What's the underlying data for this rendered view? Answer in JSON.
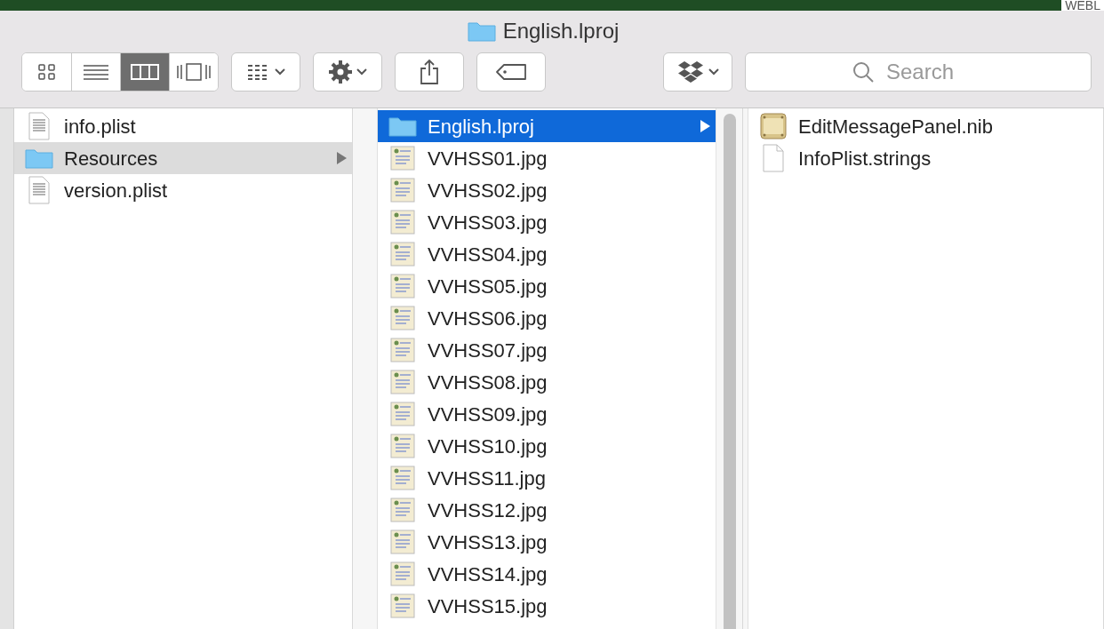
{
  "desktop": {
    "label": "WEBL"
  },
  "window": {
    "title": "English.lproj"
  },
  "toolbar": {
    "view_modes": [
      {
        "kind": "icons",
        "selected": false
      },
      {
        "kind": "list",
        "selected": false
      },
      {
        "kind": "columns",
        "selected": true
      },
      {
        "kind": "coverflow",
        "selected": false
      }
    ],
    "buttons": [
      {
        "kind": "arrange"
      },
      {
        "kind": "action"
      },
      {
        "kind": "share"
      },
      {
        "kind": "tag"
      },
      {
        "kind": "dropbox"
      }
    ],
    "search": {
      "placeholder": "Search"
    }
  },
  "columns": [
    {
      "active": false,
      "items": [
        {
          "name": "info.plist",
          "kind": "plist",
          "selected": false
        },
        {
          "name": "Resources",
          "kind": "folder",
          "selected": true
        },
        {
          "name": "version.plist",
          "kind": "plist",
          "selected": false
        }
      ]
    },
    {
      "active": true,
      "items": [
        {
          "name": "English.lproj",
          "kind": "folder",
          "selected": true
        },
        {
          "name": "VVHSS01.jpg",
          "kind": "jpg",
          "selected": false
        },
        {
          "name": "VVHSS02.jpg",
          "kind": "jpg",
          "selected": false
        },
        {
          "name": "VVHSS03.jpg",
          "kind": "jpg",
          "selected": false
        },
        {
          "name": "VVHSS04.jpg",
          "kind": "jpg",
          "selected": false
        },
        {
          "name": "VVHSS05.jpg",
          "kind": "jpg",
          "selected": false
        },
        {
          "name": "VVHSS06.jpg",
          "kind": "jpg",
          "selected": false
        },
        {
          "name": "VVHSS07.jpg",
          "kind": "jpg",
          "selected": false
        },
        {
          "name": "VVHSS08.jpg",
          "kind": "jpg",
          "selected": false
        },
        {
          "name": "VVHSS09.jpg",
          "kind": "jpg",
          "selected": false
        },
        {
          "name": "VVHSS10.jpg",
          "kind": "jpg",
          "selected": false
        },
        {
          "name": "VVHSS11.jpg",
          "kind": "jpg",
          "selected": false
        },
        {
          "name": "VVHSS12.jpg",
          "kind": "jpg",
          "selected": false
        },
        {
          "name": "VVHSS13.jpg",
          "kind": "jpg",
          "selected": false
        },
        {
          "name": "VVHSS14.jpg",
          "kind": "jpg",
          "selected": false
        },
        {
          "name": "VVHSS15.jpg",
          "kind": "jpg",
          "selected": false
        }
      ]
    },
    {
      "items": [
        {
          "name": "EditMessagePanel.nib",
          "kind": "nib",
          "selected": false
        },
        {
          "name": "InfoPlist.strings",
          "kind": "strings",
          "selected": false
        }
      ]
    }
  ]
}
